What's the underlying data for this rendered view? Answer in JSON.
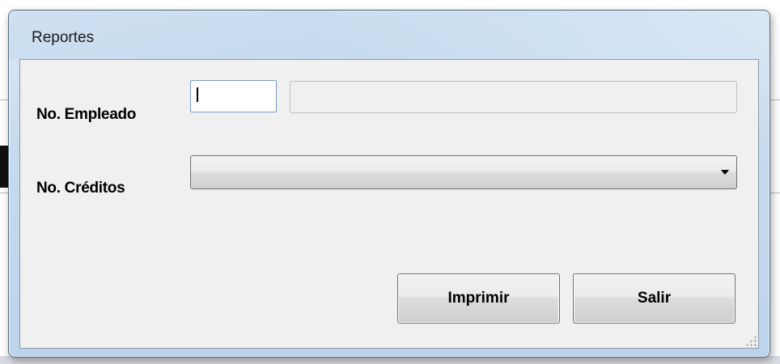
{
  "window": {
    "title": "Reportes"
  },
  "form": {
    "empleado_label": "No. Empleado",
    "empleado_value": "",
    "empleado_name_value": "",
    "creditos_label": "No. Créditos",
    "creditos_selected": ""
  },
  "buttons": {
    "print_label": "Imprimir",
    "exit_label": "Salir"
  },
  "colors": {
    "titlebar": "#c7dbee",
    "client_bg": "#f0f0f0",
    "textbox_border": "#7a9cc6"
  }
}
